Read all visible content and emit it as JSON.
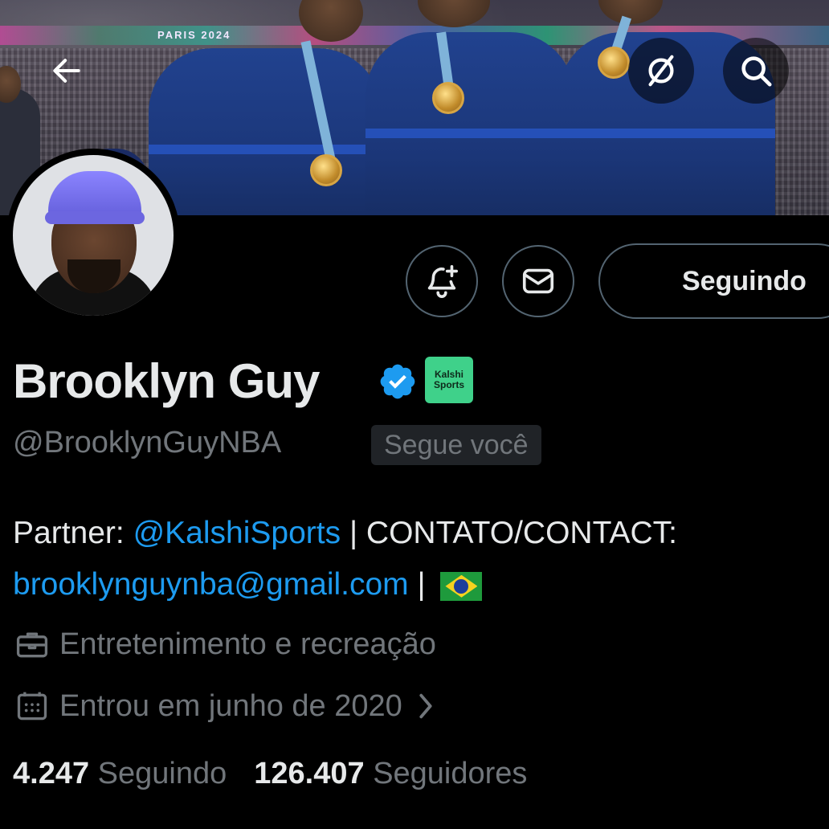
{
  "banner": {
    "ribbon_text": "PARIS 2024"
  },
  "nav": {
    "back_icon": "arrow-left-icon",
    "grok_icon": "slash-circle-icon",
    "search_icon": "search-icon"
  },
  "actions": {
    "notify_icon": "bell-plus-icon",
    "message_icon": "mail-icon",
    "follow_label": "Seguindo"
  },
  "profile": {
    "name": "Brooklyn Guy",
    "verified": true,
    "affiliate_badge": {
      "line1": "Kalshi",
      "line2": "Sports",
      "color": "#3fd18a"
    },
    "handle": "@BrooklynGuyNBA",
    "follows_you_label": "Segue você",
    "bio": {
      "prefix": "Partner: ",
      "mention": "@KalshiSports",
      "middle": " | CONTATO/CONTACT:",
      "email": "brooklynguynba@gmail.com",
      "suffix": " |"
    },
    "category": "Entretenimento e recreação",
    "joined": "Entrou em junho de 2020"
  },
  "stats": {
    "following_count": "4.247",
    "following_label": "Seguindo",
    "followers_count": "126.407",
    "followers_label": "Seguidores"
  },
  "colors": {
    "background": "#000000",
    "text": "#e7e9ea",
    "secondary": "#71767b",
    "link": "#1d9bf0",
    "border": "#536471"
  }
}
